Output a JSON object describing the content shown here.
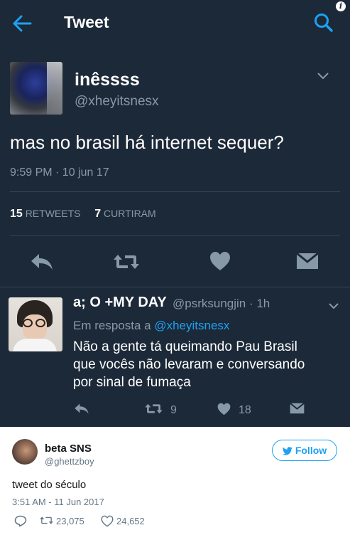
{
  "header": {
    "title": "Tweet",
    "icons": {
      "back": "arrow-left-icon",
      "search": "search-icon",
      "info": "info-icon"
    }
  },
  "main_tweet": {
    "display_name": "inêssss",
    "handle": "@xheyitsnesx",
    "text": "mas no brasil há internet sequer?",
    "timestamp": "9:59 PM · 10 jun 17",
    "retweets_count": "15",
    "retweets_label": "RETWEETS",
    "likes_count": "7",
    "likes_label": "CURTIRAM",
    "actions": [
      "reply-icon",
      "retweet-icon",
      "heart-icon",
      "direct-message-icon"
    ]
  },
  "reply": {
    "display_name": "a; O +MY DAY",
    "handle_time": "@psrksungjin · 1h",
    "in_reply_prefix": "Em resposta a",
    "in_reply_handle": "@xheyitsnesx",
    "text_lines": [
      "Não a gente tá queimando Pau Brasil",
      "que vocês não levaram e conversando",
      "por sinal de fumaça"
    ],
    "retweet_count": "9",
    "like_count": "18"
  },
  "card": {
    "display_name": "beta SNS",
    "handle": "@ghettzboy",
    "follow_label": "Follow",
    "text": "tweet do século",
    "timestamp": "3:51 AM - 11 Jun 2017",
    "retweet_count": "23,075",
    "like_count": "24,652"
  },
  "colors": {
    "dark_bg": "#1c2938",
    "accent_blue": "#1da1f2",
    "muted_text": "#8899a6",
    "divider": "#38444d"
  }
}
